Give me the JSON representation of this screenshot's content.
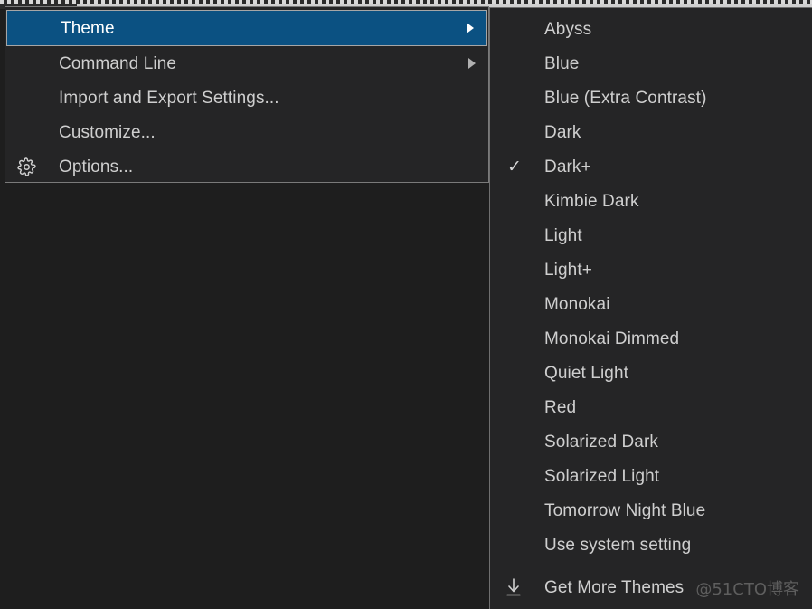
{
  "window": {
    "background_color": "#1e1e1e",
    "menu_background_color": "#252526",
    "menu_border_color": "#7a7a7a",
    "selection_color": "#0b5182",
    "text_color": "#cfcfcf"
  },
  "main_menu": {
    "items": [
      {
        "label": "Theme",
        "icon": "",
        "has_submenu": true,
        "selected": true,
        "arrow": "submenu-arrow-icon"
      },
      {
        "label": "Command Line",
        "icon": "",
        "has_submenu": true,
        "selected": false,
        "arrow": "submenu-arrow-icon"
      },
      {
        "label": "Import and Export Settings...",
        "icon": "",
        "has_submenu": false,
        "selected": false,
        "arrow": ""
      },
      {
        "label": "Customize...",
        "icon": "",
        "has_submenu": false,
        "selected": false,
        "arrow": ""
      },
      {
        "label": "Options...",
        "icon": "gear-icon",
        "has_submenu": false,
        "selected": false,
        "arrow": ""
      }
    ]
  },
  "theme_submenu": {
    "items": [
      {
        "label": "Abyss",
        "checked": false
      },
      {
        "label": "Blue",
        "checked": false
      },
      {
        "label": "Blue (Extra Contrast)",
        "checked": false
      },
      {
        "label": "Dark",
        "checked": false
      },
      {
        "label": "Dark+",
        "checked": true
      },
      {
        "label": "Kimbie Dark",
        "checked": false
      },
      {
        "label": "Light",
        "checked": false
      },
      {
        "label": "Light+",
        "checked": false
      },
      {
        "label": "Monokai",
        "checked": false
      },
      {
        "label": "Monokai Dimmed",
        "checked": false
      },
      {
        "label": "Quiet Light",
        "checked": false
      },
      {
        "label": "Red",
        "checked": false
      },
      {
        "label": "Solarized Dark",
        "checked": false
      },
      {
        "label": "Solarized Light",
        "checked": false
      },
      {
        "label": "Tomorrow Night Blue",
        "checked": false
      },
      {
        "label": "Use system setting",
        "checked": false
      }
    ],
    "check_glyph": "✓",
    "footer": {
      "label": "Get More Themes",
      "icon": "download-icon"
    }
  },
  "watermark": {
    "text": "@51CTO博客"
  }
}
